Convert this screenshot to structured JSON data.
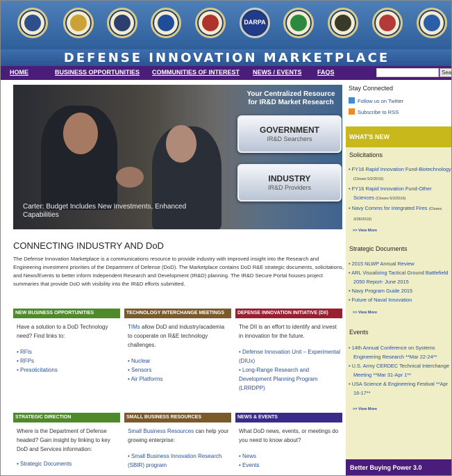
{
  "seals": [
    {
      "name": "dod-seal",
      "fill": "#2f4e8c"
    },
    {
      "name": "army-seal",
      "fill": "#c9a337"
    },
    {
      "name": "navy-seal",
      "fill": "#2d3f6e"
    },
    {
      "name": "air-force-seal",
      "fill": "#1f4d9a"
    },
    {
      "name": "marines-seal",
      "fill": "#b0322c"
    },
    {
      "name": "darpa-seal",
      "fill": "#223a8a",
      "label": "DARPA"
    },
    {
      "name": "mda-seal",
      "fill": "#2c8a3e"
    },
    {
      "name": "socom-seal",
      "fill": "#3a3a2a"
    },
    {
      "name": "dla-seal",
      "fill": "#b43a3a"
    },
    {
      "name": "disa-seal",
      "fill": "#2a5fa8"
    }
  ],
  "site_title": "DEFENSE INNOVATION MARKETPLACE",
  "nav": {
    "items": [
      "HOME",
      "BUSINESS OPPORTUNITIES",
      "COMMUNITIES OF INTEREST",
      "NEWS / EVENTS",
      "FAQS"
    ],
    "search_button": "Search"
  },
  "hero": {
    "caption": "Carter: Budget Includes New Investments, Enhanced Capabilities",
    "resource_text": "Your Centralized Resource for IR&D Market Research",
    "government": {
      "title": "GOVERNMENT",
      "subtitle": "IR&D Searchers"
    },
    "industry": {
      "title": "INDUSTRY",
      "subtitle": "IR&D Providers"
    }
  },
  "intro": {
    "heading": "CONNECTING INDUSTRY AND DoD",
    "text": "The Defense Innovation Marketplace is a communications resource to provide industry with improved insight into the Research and Engineering investment priorities of the Department of Defense (DoD). The Marketplace contains DoD R&E strategic documents, solicitations, and News/Events to better inform Independent Research and Development (IR&D) planning. The IR&D Secure Portal houses project summaries that provide DoD with visibility into the IR&D efforts submitted."
  },
  "boxes": [
    {
      "title": "NEW BUSINESS OPPORTUNITIES",
      "color": "#4e8a2a",
      "text": "Have a solution to a DoD Technology need? Find links to:",
      "links": [
        "RFIs",
        "RFPs",
        "Presolicitations"
      ]
    },
    {
      "title": "TECHNOLOGY INTERCHANGE MEETINGS",
      "color": "#7a5a2a",
      "link_word": "TIMs",
      "text": " allow DoD and industry/academia to cooperate on R&E technology challenges.",
      "links": [
        "Nuclear",
        "Sensors",
        "Air Platforms"
      ]
    },
    {
      "title": "DEFENSE INNOVATION INITIATIVE (DII)",
      "color": "#9a1f2f",
      "text": "The DII is an effort to identify and invest in innovation for the future.",
      "links": [
        "Defense Innovation Unit – Experimental (DIUx)",
        "Long-Range Research and Development Planning Program (LRRDPP)"
      ]
    },
    {
      "title": "STRATEGIC DIRECTION",
      "color": "#4e8a2a",
      "text": "Where is the Department of Defense headed? Gain insight by linking to key DoD and Services information:",
      "links": [
        "Strategic Documents"
      ]
    },
    {
      "title": "SMALL BUSINESS RESOURCES",
      "color": "#7a5a2a",
      "link_word": "Small Business Resources",
      "text": " can help your growing enterprise:",
      "links": [
        "Small Business Innovation Research (SBIR) program"
      ]
    },
    {
      "title": "NEWS & EVENTS",
      "color": "#3a2a8a",
      "text": "What DoD news, events, or meetings do you need to know about?",
      "links": [
        "News",
        "Events"
      ]
    }
  ],
  "right": {
    "stay_connected": "Stay Connected",
    "twitter": "Follow us on Twitter",
    "rss": "Subscribe to RSS",
    "whats_new": "WHAT'S NEW",
    "solicitations_title": "Solicitations",
    "solicitations": [
      {
        "text": "FY16 Rapid Innovation Fund-Biotechnology",
        "note": "(Closes 5/2/2016)"
      },
      {
        "text": "FY16 Rapid Innovation Fund-Other Sciences",
        "note": "(Closes 5/2/2016)"
      },
      {
        "text": "Navy Comms for Integrated Fires",
        "note": "(Closes 3/28/2016)"
      }
    ],
    "view_more": ">> View More",
    "strategic_title": "Strategic Documents",
    "strategic": [
      "2015 NLWP Annual Review",
      "ARL Visualizing Tactical Ground Battlefield 2050 Report- June 2015",
      "Navy Program Guide 2015",
      "Future of Naval Innovation"
    ],
    "events_title": "Events",
    "events": [
      "14th Annual Conference on Systems Engineering Research **Mar 22-24**",
      "U.S. Army CERDEC Technical Interchange Meeting **Mar 31-Apr 1**",
      "USA Science & Engineering Festival **Apr 16-17**"
    ],
    "bbp": "Better Buying Power 3.0"
  }
}
